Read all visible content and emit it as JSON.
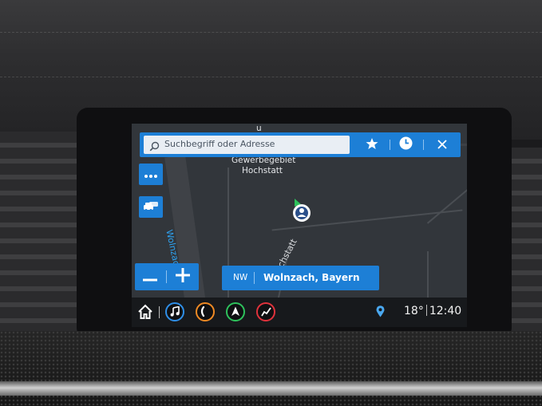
{
  "search": {
    "placeholder": "Suchbegriff oder Adresse"
  },
  "icons": {
    "search": "search-icon",
    "favorites": "star-icon",
    "recents": "clock-icon",
    "close": "close-icon",
    "menu": "more-options-icon",
    "traffic": "traffic-icon",
    "zoom_out": "minus-icon",
    "zoom_in": "plus-icon",
    "home": "home-icon",
    "music": "music-icon",
    "phone": "phone-icon",
    "navigation": "navigation-icon",
    "onstar": "onstar-icon",
    "location": "location-pin-icon"
  },
  "map": {
    "area_label_line1": "Gewerbegebiet",
    "area_label_line2": "Hochstatt",
    "street_wolnzach": "Wolnzach",
    "street_hochstatt": "Hochstatt",
    "top_fragment": "u"
  },
  "status": {
    "heading": "NW",
    "place": "Wolnzach, Bayern"
  },
  "bottom_bar": {
    "temperature": "18°",
    "time": "12:40"
  },
  "colors": {
    "accent": "#1d7fd6",
    "map_background": "#32363b",
    "street_label": "#2ea3f2",
    "music_ring": "#2f8fe8",
    "phone_ring": "#f08a24",
    "nav_ring": "#2ec25c",
    "onstar_ring": "#e0323c"
  }
}
